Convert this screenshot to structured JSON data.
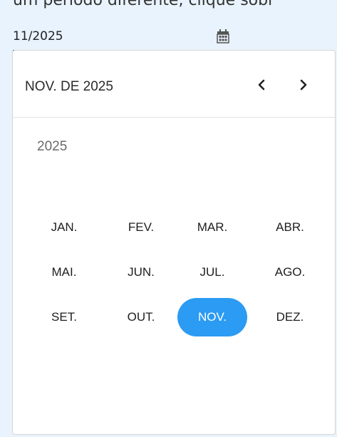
{
  "background_text": "um período diferente, clique sobr",
  "date_input": {
    "value": "11/2025",
    "icon": "calendar-icon"
  },
  "picker": {
    "period_label": "NOV. DE 2025",
    "prev_icon": "chevron-left-icon",
    "next_icon": "chevron-right-icon",
    "year": "2025",
    "months": [
      "JAN.",
      "FEV.",
      "MAR.",
      "ABR.",
      "MAI.",
      "JUN.",
      "JUL.",
      "AGO.",
      "SET.",
      "OUT.",
      "NOV.",
      "DEZ."
    ],
    "selected_month": "NOV."
  },
  "colors": {
    "accent": "#2b9bf3",
    "page_background": "#e8f3fd"
  }
}
